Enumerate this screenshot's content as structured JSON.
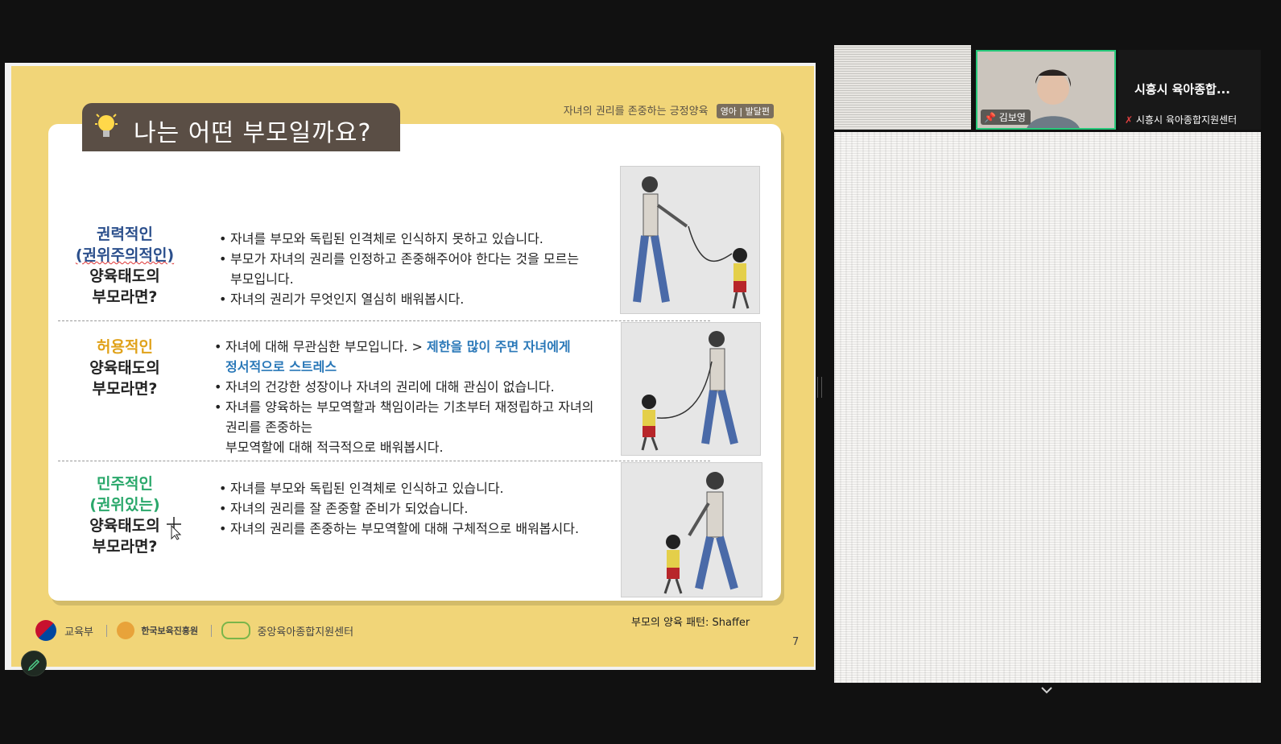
{
  "slide": {
    "title": "나는 어떤 부모일까요?",
    "subtitle": "자녀의 권리를 존중하는 긍정양육",
    "subtitle_tag": "영아 | 발달편",
    "rows": [
      {
        "label_lines": [
          "권력적인",
          "(권위주의적인)",
          "양육태도의",
          "부모라면?"
        ],
        "bullets": [
          "자녀를 부모와 독립된 인격체로 인식하지 못하고 있습니다.",
          "부모가 자녀의 권리를 인정하고 존중해주어야 한다는 것을 모르는",
          "자녀의 권리가 무엇인지 열심히 배워봅시다."
        ],
        "continuation": "부모입니다."
      },
      {
        "label_lines": [
          "허용적인",
          "양육태도의",
          "부모라면?"
        ],
        "bullet1_prefix": "자녀에 대해 무관심한 부모입니다. > ",
        "bullet1_highlight": "제한을 많이 주면 자녀에게",
        "bullet1_highlight2": "정서적으로 스트레스",
        "bullets": [
          "자녀의 건강한 성장이나 자녀의 권리에 대해 관심이 없습니다.",
          "자녀를 양육하는 부모역할과 책임이라는 기초부터 재정립하고 자녀의"
        ],
        "continuations": [
          "권리를 존중하는",
          "부모역할에 대해 적극적으로 배워봅시다."
        ]
      },
      {
        "label_lines": [
          "민주적인",
          "(권위있는)",
          "양육태도의",
          "부모라면?"
        ],
        "bullets": [
          "자녀를 부모와 독립된 인격체로 인식하고 있습니다.",
          "자녀의 권리를 잘 존중할 준비가 되었습니다.",
          "자녀의 권리를 존중하는 부모역할에 대해 구체적으로 배워봅시다."
        ]
      }
    ],
    "caption": "부모의 양육 패턴: Shaffer",
    "page_number": "7",
    "footer_logos": [
      "교육부",
      "한국보육진흥원",
      "중앙육아종합지원센터"
    ]
  },
  "participants": {
    "speaker_name": "김보영",
    "org_tile_title": "시흥시 육아종합...",
    "org_tile_name": "시흥시 육아종합지원센터"
  },
  "colors": {
    "slide_bg": "#f1d578",
    "title_tab": "#5a4e45",
    "label_authoritarian": "#2b4f8c",
    "label_permissive": "#e0a21a",
    "label_democratic": "#2aa86b",
    "highlight": "#2a78b8",
    "active_speaker_border": "#27c97a"
  },
  "icons": [
    "lightbulb-icon",
    "pin-icon",
    "mic-muted-icon",
    "pencil-icon",
    "move-cursor-icon",
    "chevron-down-icon"
  ]
}
